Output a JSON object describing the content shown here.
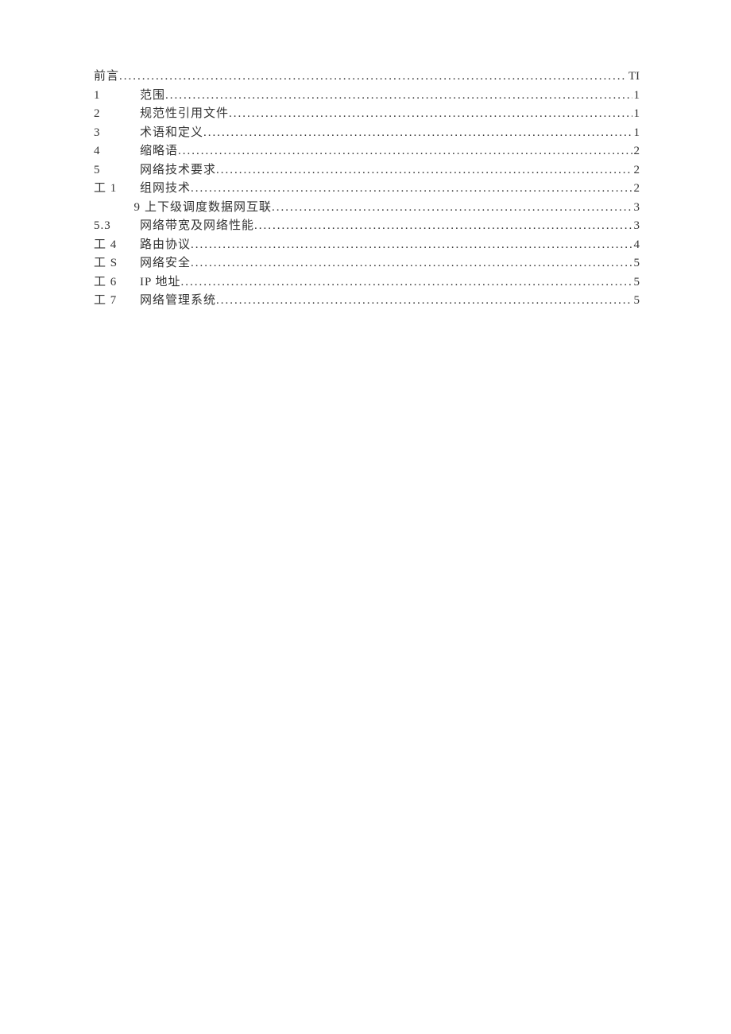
{
  "toc": {
    "entries": [
      {
        "num": "前言",
        "title": "",
        "page": "TI",
        "first": true
      },
      {
        "num": "1",
        "title": "范围",
        "page": "1"
      },
      {
        "num": "2",
        "title": "规范性引用文件",
        "page": "1"
      },
      {
        "num": "3",
        "title": "术语和定义",
        "page": "1"
      },
      {
        "num": "4",
        "title": "缩略语",
        "page": "2"
      },
      {
        "num": "5",
        "title": "网络技术要求",
        "page": "2"
      },
      {
        "num": "工 1",
        "title": "组网技术",
        "page": "2"
      },
      {
        "num": "9",
        "title": "上下级调度数据网互联",
        "page": "3",
        "indent": true
      },
      {
        "num": "5.3",
        "title": "网络带宽及网络性能",
        "page": "3"
      },
      {
        "num": "工 4",
        "title": "路由协议",
        "page": "4"
      },
      {
        "num": "工 S",
        "title": "网络安全",
        "page": "5"
      },
      {
        "num": "工 6",
        "title": "IP 地址",
        "page": "5"
      },
      {
        "num": "工 7",
        "title": "网络管理系统",
        "page": "5"
      }
    ]
  }
}
